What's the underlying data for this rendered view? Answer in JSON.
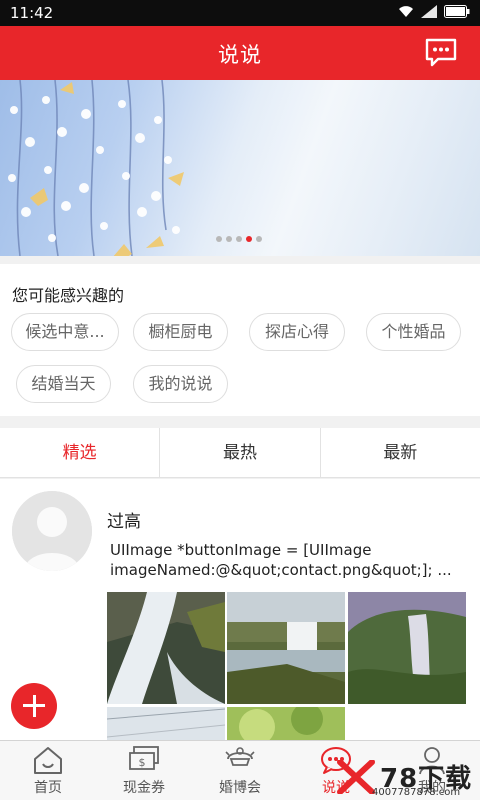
{
  "status_bar": {
    "time": "11:42"
  },
  "header": {
    "title": "说说",
    "message_icon": "chat-bubble-icon"
  },
  "banner": {
    "slide_count": 5,
    "active_slide": 4
  },
  "interests": {
    "title": "您可能感兴趣的",
    "tags": [
      "候选中意...",
      "橱柜厨电",
      "探店心得",
      "个性婚品",
      "结婚当天",
      "我的说说"
    ]
  },
  "tabs": [
    {
      "label": "精选",
      "active": true
    },
    {
      "label": "最热",
      "active": false
    },
    {
      "label": "最新",
      "active": false
    }
  ],
  "post": {
    "author": "过高",
    "text": "UIImage *buttonImage = [UIImage\nimageNamed:@&quot;contact.png&quot;]; ..."
  },
  "bottom_nav": [
    {
      "label": "首页",
      "icon": "home-icon"
    },
    {
      "label": "现金券",
      "icon": "cash-coupon-icon"
    },
    {
      "label": "婚博会",
      "icon": "wedding-expo-icon"
    },
    {
      "label": "说说",
      "icon": "chat-icon",
      "active": true
    },
    {
      "label": "我的",
      "icon": "user-icon"
    }
  ],
  "watermark": {
    "brand": "78下载",
    "url": "4007787878.com"
  },
  "colors": {
    "accent": "#e8262a",
    "status_bar": "#0d0d0d",
    "tag_border": "#dedede"
  }
}
